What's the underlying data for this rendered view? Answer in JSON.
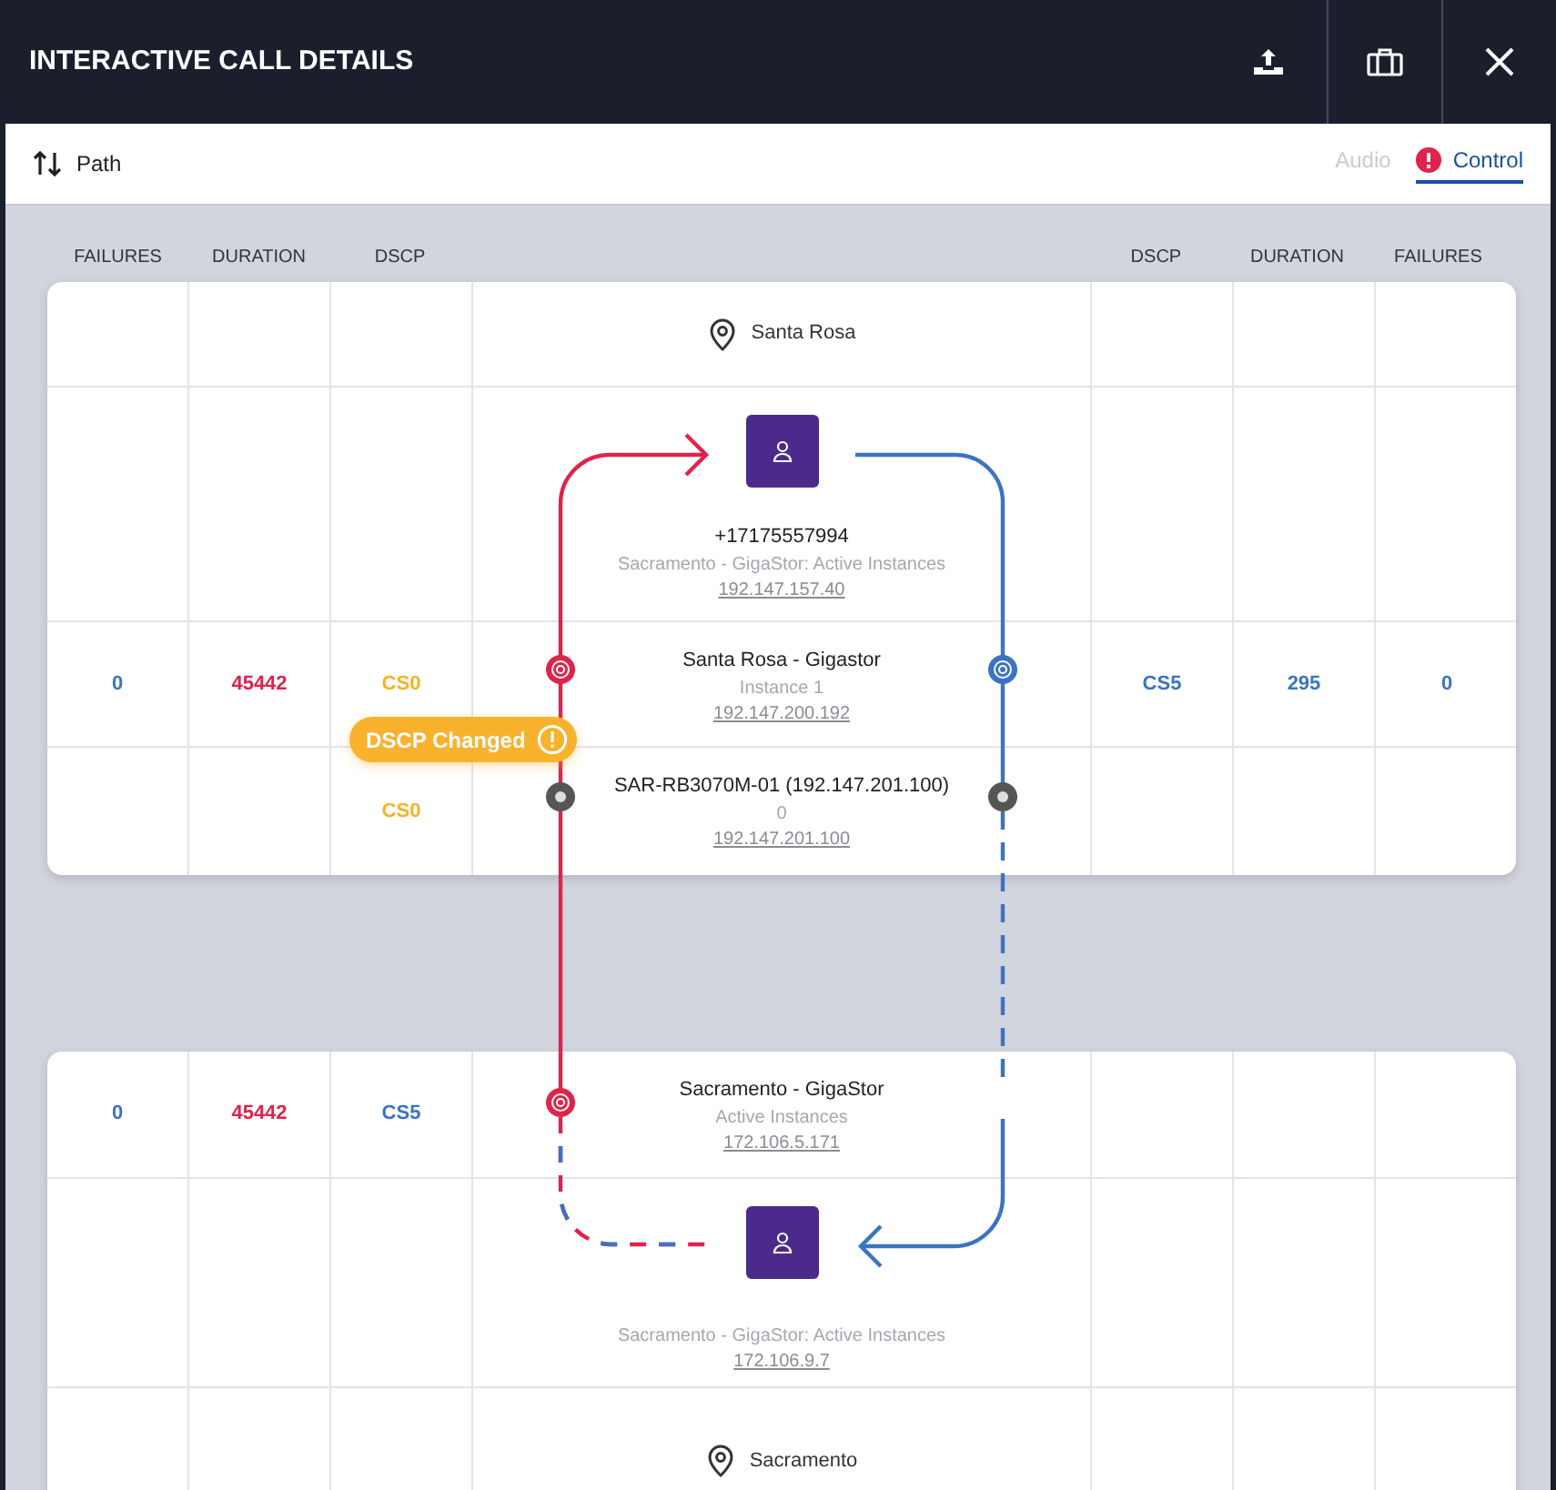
{
  "header": {
    "title": "INTERACTIVE CALL DETAILS"
  },
  "toolbar": {
    "sort_label": "Path",
    "tabs": [
      {
        "label": "Audio",
        "selected": false,
        "alert": false
      },
      {
        "label": "Control",
        "selected": true,
        "alert": true
      }
    ]
  },
  "columns": {
    "left": [
      "FAILURES",
      "DURATION",
      "DSCP"
    ],
    "right": [
      "DSCP",
      "DURATION",
      "FAILURES"
    ]
  },
  "cards": [
    {
      "rows": [
        {
          "kind": "location",
          "name": "Santa Rosa"
        },
        {
          "kind": "endpoint",
          "title": "+17175557994",
          "subtitle": "Sacramento - GigaStor: Active Instances",
          "address": "192.147.157.40"
        },
        {
          "kind": "hop",
          "title": "Santa Rosa - Gigastor",
          "subtitle": "Instance 1",
          "address": "192.147.200.192",
          "left": {
            "failures": {
              "text": "0",
              "color": "#3b73c4"
            },
            "duration": {
              "text": "45442",
              "color": "#e0234a"
            },
            "dscp": {
              "text": "CS0",
              "color": "#f5b324"
            }
          },
          "right": {
            "dscp": {
              "text": "CS5",
              "color": "#3b73c4"
            },
            "duration": {
              "text": "295",
              "color": "#3b73c4"
            },
            "failures": {
              "text": "0",
              "color": "#3b73c4"
            }
          }
        },
        {
          "kind": "hop",
          "title": "SAR-RB3070M-01 (192.147.201.100)",
          "subtitle": "0",
          "address": "192.147.201.100",
          "left": {
            "dscp": {
              "text": "CS0",
              "color": "#f5b324"
            }
          },
          "right": {}
        }
      ]
    },
    {
      "rows": [
        {
          "kind": "hop",
          "title": "Sacramento - GigaStor",
          "subtitle": "Active Instances",
          "address": "172.106.5.171",
          "left": {
            "failures": {
              "text": "0",
              "color": "#3b73c4"
            },
            "duration": {
              "text": "45442",
              "color": "#e0234a"
            },
            "dscp": {
              "text": "CS5",
              "color": "#3b73c4"
            }
          },
          "right": {}
        },
        {
          "kind": "endpoint",
          "subtitle": "Sacramento - GigaStor: Active Instances",
          "address": "172.106.9.7"
        },
        {
          "kind": "location",
          "name": "Sacramento"
        }
      ]
    }
  ],
  "badge": {
    "label": "DSCP Changed"
  }
}
